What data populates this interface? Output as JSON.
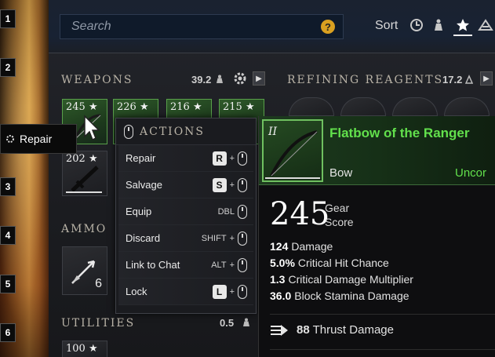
{
  "slot_numbers": [
    "1",
    "2",
    "3",
    "4",
    "5",
    "6"
  ],
  "search": {
    "placeholder": "Search",
    "help": "?"
  },
  "sort": {
    "label": "Sort",
    "icons": [
      "clock-icon",
      "weight-icon",
      "star-icon",
      "tier-icon"
    ],
    "active": "star-icon"
  },
  "sections": {
    "weapons": {
      "title": "WEAPONS",
      "weight": "39.2"
    },
    "refining": {
      "title": "REFINING REAGENTS",
      "weight": "17.2"
    },
    "ammo": {
      "title": "AMMO"
    },
    "utilities": {
      "title": "UTILITIES",
      "weight": "0.5"
    }
  },
  "weapon_tiles": [
    {
      "score": "245 ★"
    },
    {
      "score": "226 ★"
    },
    {
      "score": "216 ★"
    },
    {
      "score": "215 ★"
    },
    {
      "score": "202 ★"
    }
  ],
  "ammo_tile": {
    "qty": "6"
  },
  "utility_tile": {
    "score": "100 ★"
  },
  "repair_tooltip": {
    "label": "Repair"
  },
  "actions": {
    "title": "ACTIONS",
    "items": [
      {
        "label": "Repair",
        "key": "R",
        "plus": "+"
      },
      {
        "label": "Salvage",
        "key": "S",
        "plus": "+"
      },
      {
        "label": "Equip",
        "key": "DBL"
      },
      {
        "label": "Discard",
        "key": "SHIFT",
        "plus": "+"
      },
      {
        "label": "Link to Chat",
        "key": "ALT",
        "plus": "+"
      },
      {
        "label": "Lock",
        "key": "L",
        "plus": "+"
      }
    ]
  },
  "item_card": {
    "tier": "II",
    "name": "Flatbow of the Ranger",
    "type": "Bow",
    "rarity": "Uncor",
    "gear_score": "245",
    "gear_label_1": "Gear",
    "gear_label_2": "Score",
    "stats": [
      {
        "value": "124",
        "label": "Damage"
      },
      {
        "value": "5.0%",
        "label": "Critical Hit Chance"
      },
      {
        "value": "1.3",
        "label": "Critical Damage Multiplier"
      },
      {
        "value": "36.0",
        "label": "Block Stamina Damage"
      }
    ],
    "perk": {
      "value": "88",
      "label": "Thrust Damage"
    }
  },
  "colors": {
    "accent_green": "#62e04c",
    "rarity_border": "#59a04a",
    "gold": "#d39b45"
  }
}
